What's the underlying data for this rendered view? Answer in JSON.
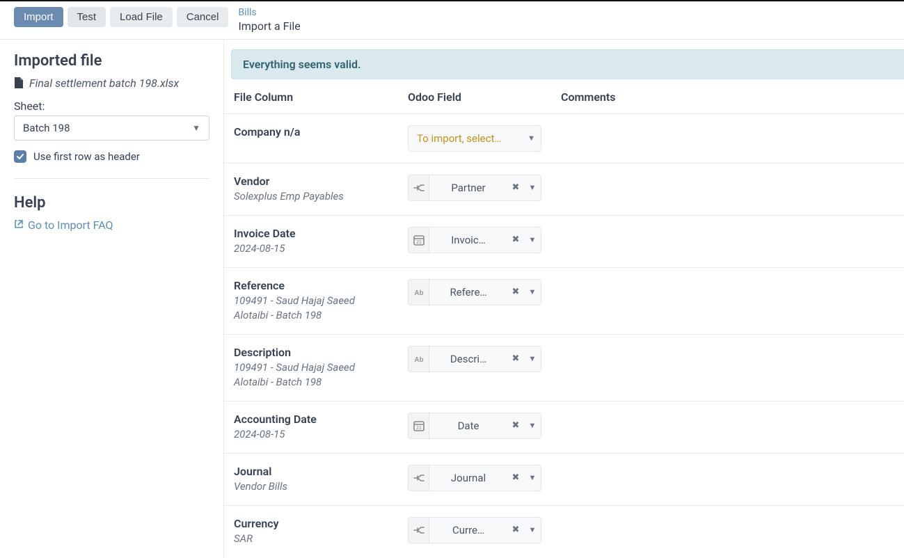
{
  "topbar": {
    "import_label": "Import",
    "test_label": "Test",
    "loadfile_label": "Load File",
    "cancel_label": "Cancel",
    "breadcrumb_parent": "Bills",
    "breadcrumb_current": "Import a File"
  },
  "sidebar": {
    "imported_file_heading": "Imported file",
    "file_name": "Final settlement batch 198.xlsx",
    "sheet_label": "Sheet:",
    "sheet_selected": "Batch 198",
    "use_first_row_label": "Use first row as header",
    "help_heading": "Help",
    "faq_link_label": "Go to Import FAQ"
  },
  "alert_text": "Everything seems valid.",
  "columns_header": {
    "file_column": "File Column",
    "odoo_field": "Odoo Field",
    "comments": "Comments"
  },
  "empty_select_label": "To import, select…",
  "rows": [
    {
      "name": "Company n/a",
      "sample": "",
      "field_type": "none",
      "field_label": ""
    },
    {
      "name": "Vendor",
      "sample": "Solexplus Emp Payables",
      "field_type": "relation",
      "field_label": "Partner"
    },
    {
      "name": "Invoice Date",
      "sample": "2024-08-15",
      "field_type": "date",
      "field_label": "Invoic…"
    },
    {
      "name": "Reference",
      "sample": "109491 - Saud Hajaj Saeed Alotaibi - Batch 198",
      "field_type": "text",
      "field_label": "Refere…"
    },
    {
      "name": "Description",
      "sample": "109491 - Saud Hajaj Saeed Alotaibi - Batch 198",
      "field_type": "text",
      "field_label": "Descri…"
    },
    {
      "name": "Accounting Date",
      "sample": "2024-08-15",
      "field_type": "date",
      "field_label": "Date"
    },
    {
      "name": "Journal",
      "sample": "Vendor Bills",
      "field_type": "relation",
      "field_label": "Journal"
    },
    {
      "name": "Currency",
      "sample": "SAR",
      "field_type": "relation",
      "field_label": "Curre…"
    }
  ]
}
